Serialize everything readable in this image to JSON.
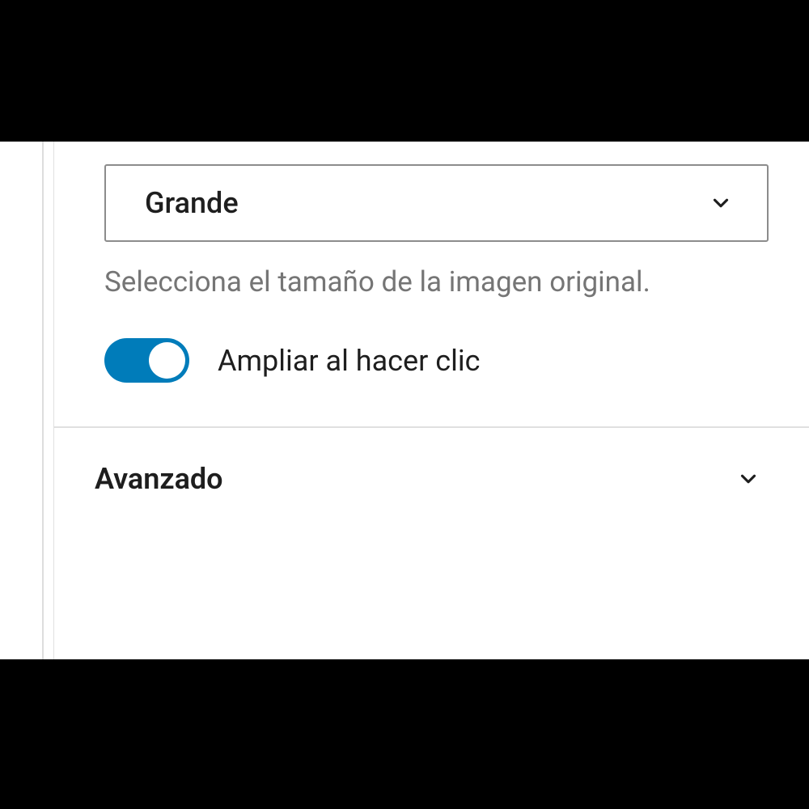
{
  "settings": {
    "sizeSelect": {
      "selected": "Grande",
      "helpText": "Selecciona el tamaño de la imagen original."
    },
    "expandToggle": {
      "label": "Ampliar al hacer clic",
      "enabled": true
    },
    "advancedSection": {
      "title": "Avanzado",
      "expanded": false
    }
  },
  "colors": {
    "accent": "#007cba",
    "text": "#1e1e1e",
    "muted": "#757575",
    "border": "#8c8c8c"
  }
}
